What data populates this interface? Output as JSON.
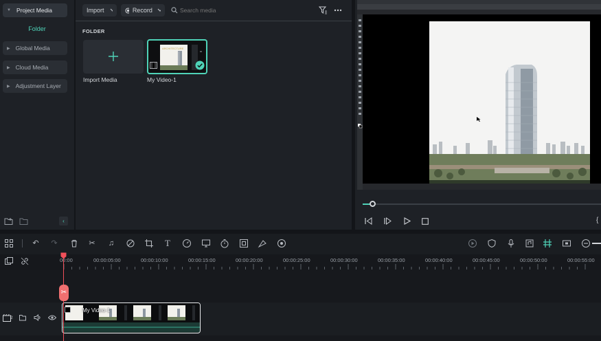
{
  "sidebar": {
    "project_media": "Project Media",
    "folder": "Folder",
    "items": [
      {
        "label": "Global Media"
      },
      {
        "label": "Cloud Media"
      },
      {
        "label": "Adjustment Layer"
      }
    ]
  },
  "media_toolbar": {
    "import_label": "Import",
    "record_label": "Record",
    "search_placeholder": "Search media"
  },
  "media": {
    "folder_heading": "FOLDER",
    "items": [
      {
        "caption": "Import Media"
      },
      {
        "caption": "My Video-1"
      }
    ]
  },
  "timeline": {
    "ticks": [
      "00:00",
      "00:00:05:00",
      "00:00:10:00",
      "00:00:15:00",
      "00:00:20:00",
      "00:00:25:00",
      "00:00:30:00",
      "00:00:35:00",
      "00:00:40:00",
      "00:00:45:00",
      "00:00:50:00",
      "00:00:55:00"
    ],
    "track_number": "2",
    "clip_title": "My Video-1"
  },
  "colors": {
    "accent": "#4fd3b8",
    "playhead": "#f0505a"
  }
}
